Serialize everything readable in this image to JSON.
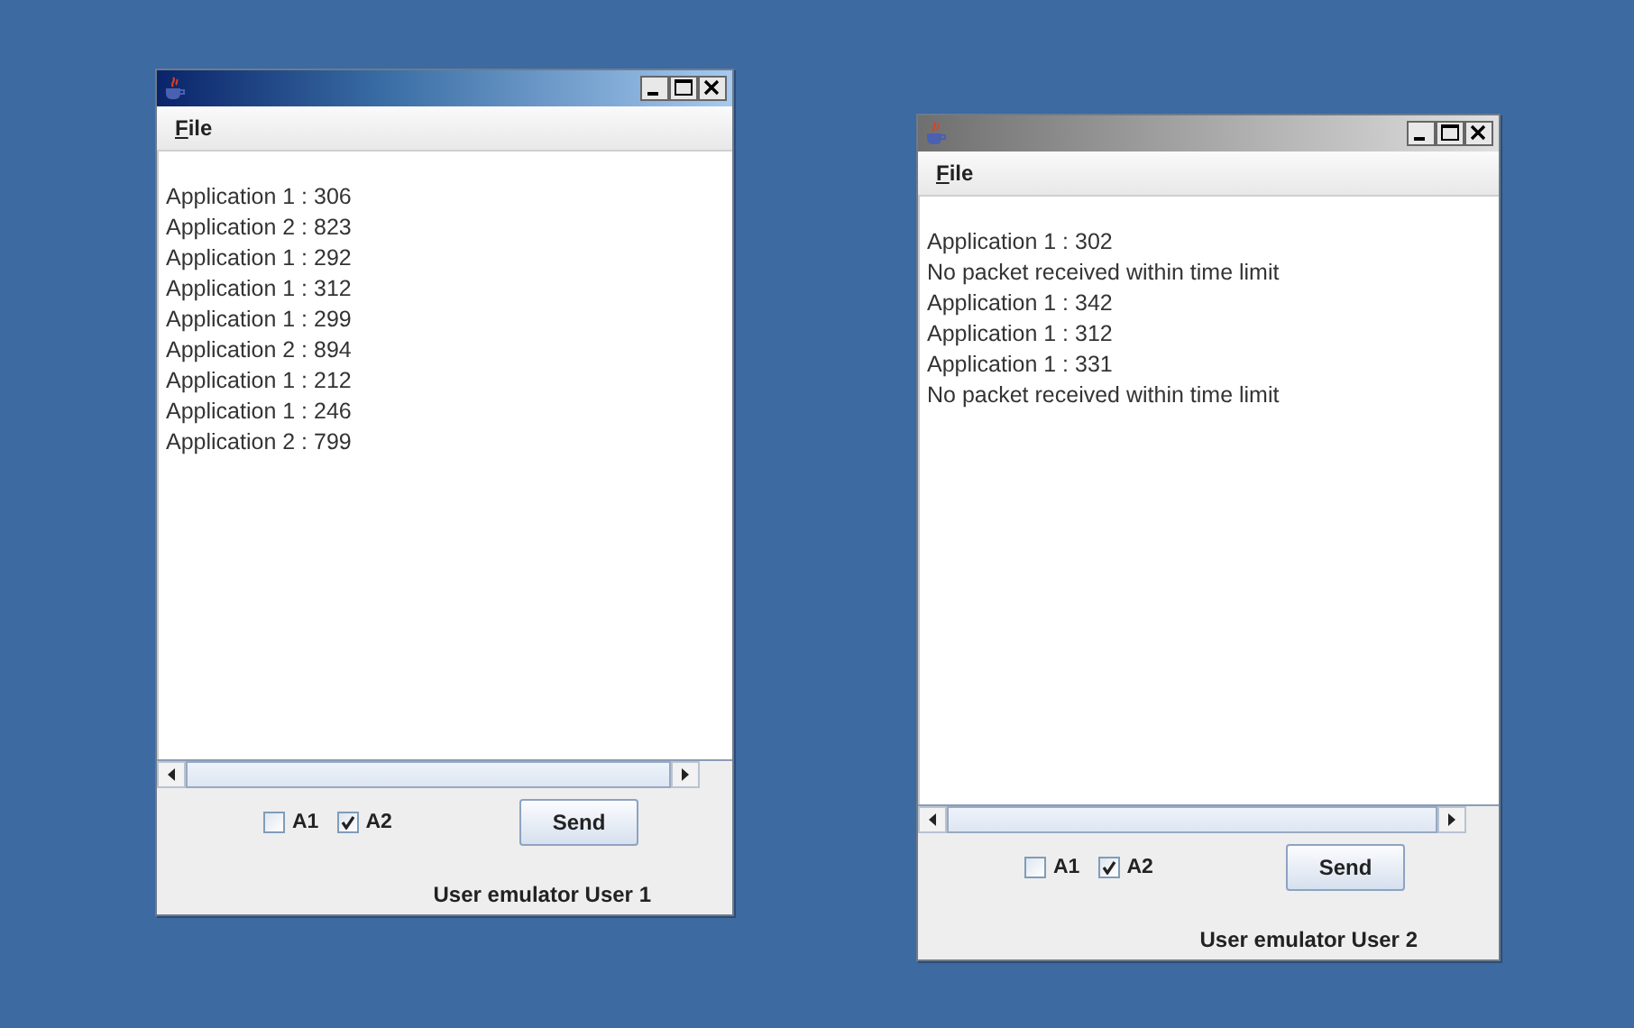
{
  "windows": [
    {
      "active": true,
      "menu": [
        "File"
      ],
      "lines": [
        "Application 1 : 306",
        "Application 2 : 823",
        "Application 1 : 292",
        "Application 1 : 312",
        "Application 1 : 299",
        "Application 2 : 894",
        "Application 1 : 212",
        "Application 1 : 246",
        "Application 2 : 799"
      ],
      "checkboxes": [
        {
          "label": "A1",
          "checked": false
        },
        {
          "label": "A2",
          "checked": true
        }
      ],
      "button": "Send",
      "status": "User emulator User 1"
    },
    {
      "active": false,
      "menu": [
        "File"
      ],
      "lines": [
        "Application 1 : 302",
        "No packet received within time limit",
        "Application 1 : 342",
        "Application 1 : 312",
        "Application 1 : 331",
        "No packet received within time limit"
      ],
      "checkboxes": [
        {
          "label": "A1",
          "checked": false
        },
        {
          "label": "A2",
          "checked": true
        }
      ],
      "button": "Send",
      "status": "User emulator User 2"
    }
  ]
}
